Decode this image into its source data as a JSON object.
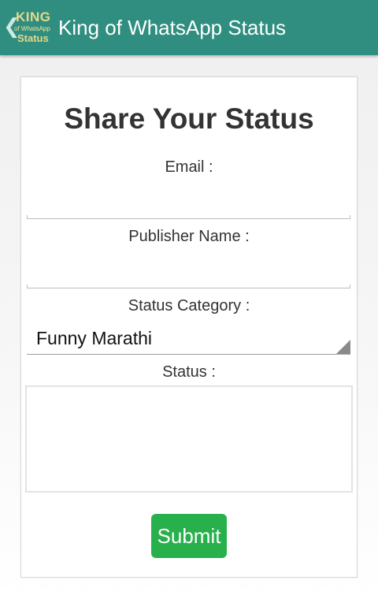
{
  "appbar": {
    "title": "King of WhatsApp Status",
    "back_glyph": "❮",
    "logo": {
      "line1": "KING",
      "line2": "of WhatsApp",
      "line3": "Status"
    },
    "background": "#2f8e7f"
  },
  "form": {
    "heading": "Share Your Status",
    "email_label": "Email :",
    "email_value": "",
    "publisher_label": "Publisher Name :",
    "publisher_value": "",
    "category_label": "Status Category :",
    "category_selected": "Funny Marathi",
    "status_label": "Status :",
    "status_value": "",
    "submit_label": "Submit",
    "submit_color": "#27b04b"
  }
}
